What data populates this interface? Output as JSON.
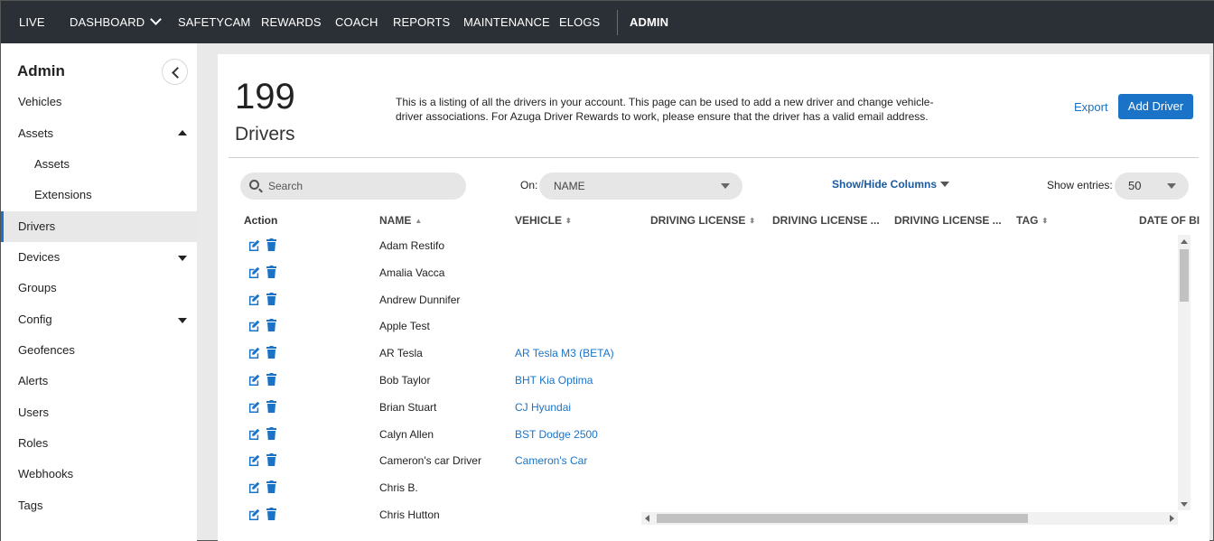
{
  "topnav": {
    "items": [
      "LIVE",
      "DASHBOARD",
      "SAFETYCAM",
      "REWARDS",
      "COACH",
      "REPORTS",
      "MAINTENANCE",
      "ELOGS"
    ],
    "admin": "ADMIN"
  },
  "sidebar": {
    "title": "Admin",
    "items": [
      "Vehicles",
      "Assets",
      "Assets",
      "Extensions",
      "Drivers",
      "Devices",
      "Groups",
      "Config",
      "Geofences",
      "Alerts",
      "Users",
      "Roles",
      "Webhooks",
      "Tags"
    ]
  },
  "header": {
    "count": "199",
    "count_label": "Drivers",
    "description": "This is a listing of all the drivers in your account. This page can be used to add a new driver and change vehicle-driver associations. For Azuga Driver Rewards to work, please ensure that the driver has a valid email address.",
    "export_label": "Export",
    "add_label": "Add Driver"
  },
  "controls": {
    "search_placeholder": "Search",
    "on_label": "On:",
    "on_value": "NAME",
    "show_hide_label": "Show/Hide Columns",
    "entries_label": "Show entries:",
    "entries_value": "50"
  },
  "table": {
    "columns": [
      "Action",
      "NAME",
      "VEHICLE",
      "DRIVING LICENSE",
      "DRIVING LICENSE ...",
      "DRIVING LICENSE ...",
      "TAG",
      "DATE OF BI"
    ],
    "rows": [
      {
        "name": "Adam Restifo",
        "vehicle": ""
      },
      {
        "name": "Amalia Vacca",
        "vehicle": ""
      },
      {
        "name": "Andrew Dunnifer",
        "vehicle": ""
      },
      {
        "name": "Apple Test",
        "vehicle": ""
      },
      {
        "name": "AR Tesla",
        "vehicle": "AR Tesla M3 (BETA)"
      },
      {
        "name": "Bob Taylor",
        "vehicle": "BHT Kia Optima"
      },
      {
        "name": "Brian Stuart",
        "vehicle": "CJ Hyundai"
      },
      {
        "name": "Calyn Allen",
        "vehicle": "BST Dodge 2500"
      },
      {
        "name": "Cameron's car Driver",
        "vehicle": "Cameron's Car"
      },
      {
        "name": "Chris B.",
        "vehicle": ""
      },
      {
        "name": "Chris Hutton",
        "vehicle": ""
      }
    ]
  },
  "colors": {
    "nav_bg": "#2b2f36",
    "accent": "#1a73c6",
    "link": "#1a73c6"
  }
}
